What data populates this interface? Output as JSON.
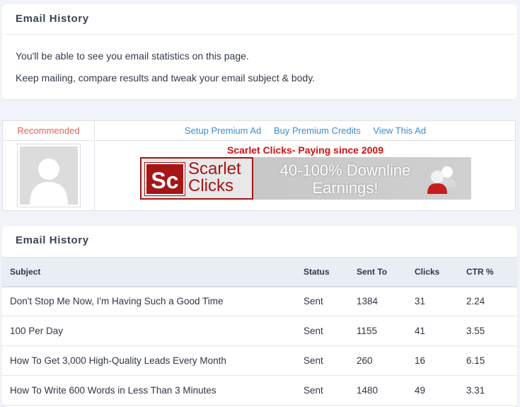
{
  "intro_card": {
    "title": "Email History",
    "line1": "You'll be able to see you email statistics on this page.",
    "line2": "Keep mailing, compare results and tweak your email subject & body."
  },
  "ad": {
    "recommended_label": "Recommended",
    "links": [
      "Setup Premium Ad",
      "Buy Premium Credits",
      "View This Ad"
    ],
    "headline": "Scarlet Clicks- Paying since 2009",
    "banner": {
      "logo_letters": "Sc",
      "brand_line1": "Scarlet",
      "brand_line2": "Clicks",
      "promo_line1": "40-100% Downline",
      "promo_line2": "Earnings!"
    }
  },
  "history": {
    "title": "Email History",
    "columns": [
      "Subject",
      "Status",
      "Sent To",
      "Clicks",
      "CTR %"
    ],
    "rows": [
      {
        "subject": "Don't Stop Me Now, I'm Having Such a Good Time",
        "status": "Sent",
        "sent_to": "1384",
        "clicks": "31",
        "ctr": "2.24"
      },
      {
        "subject": "100 Per Day",
        "status": "Sent",
        "sent_to": "1155",
        "clicks": "41",
        "ctr": "3.55"
      },
      {
        "subject": "How To Get 3,000 High-Quality Leads Every Month",
        "status": "Sent",
        "sent_to": "260",
        "clicks": "16",
        "ctr": "6.15"
      },
      {
        "subject": "How To Write 600 Words in Less Than 3 Minutes",
        "status": "Sent",
        "sent_to": "1480",
        "clicks": "49",
        "ctr": "3.31"
      }
    ]
  },
  "colors": {
    "background": "#f0f3f8",
    "link": "#3c8dd4",
    "recommended": "#e8625a",
    "headline_red": "#d11010"
  }
}
